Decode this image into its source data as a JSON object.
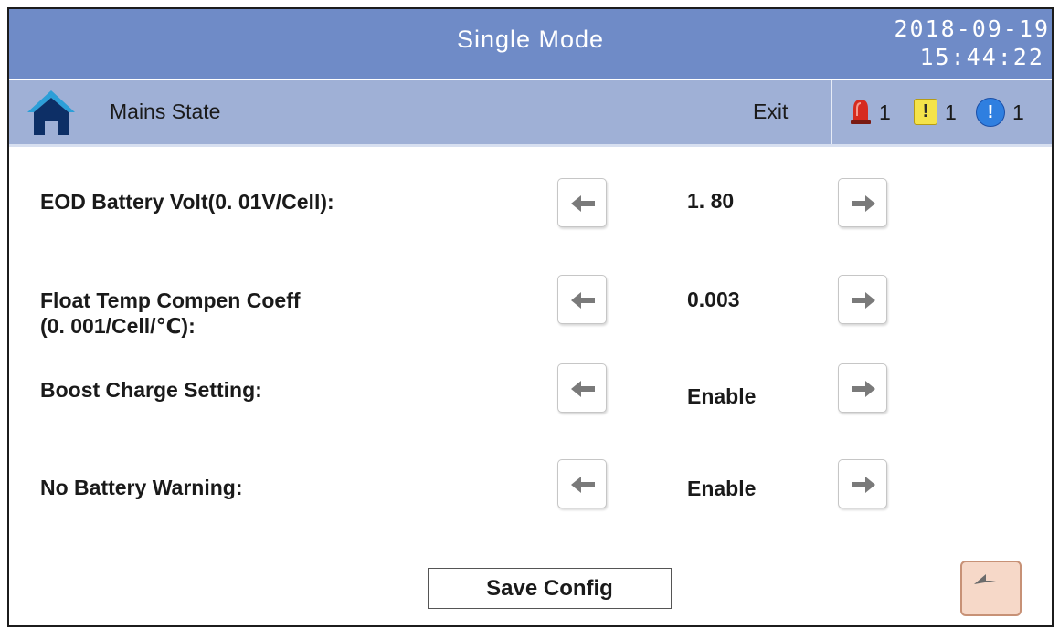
{
  "header": {
    "title": "Single Mode",
    "date": "2018-09-19",
    "time": "15:44:22"
  },
  "nav": {
    "home_icon": "home-icon",
    "label": "Mains State",
    "exit": "Exit",
    "alarms": [
      {
        "icon": "siren-icon",
        "count": "1",
        "color": "#d62b1f"
      },
      {
        "icon": "warning-icon",
        "glyph": "!",
        "count": "1",
        "color": "#f4e34a"
      },
      {
        "icon": "info-icon",
        "glyph": "!",
        "count": "1",
        "color": "#2f7fe0"
      }
    ]
  },
  "settings": [
    {
      "label": "EOD Battery Volt(0. 01V/Cell):",
      "value": "1. 80"
    },
    {
      "label_line1": "Float Temp Compen Coeff",
      "label_line2": "(0. 001/Cell/℃):",
      "value": "0.003"
    },
    {
      "label": "Boost Charge Setting:",
      "value": "Enable"
    },
    {
      "label": "No Battery Warning:",
      "value": "Enable"
    }
  ],
  "footer": {
    "save": "Save Config",
    "back_icon": "back-arrow-icon"
  },
  "colors": {
    "title_bar": "#6f8bc7",
    "nav_bar": "#9fb0d6",
    "back_button": "#f6d8c8"
  }
}
